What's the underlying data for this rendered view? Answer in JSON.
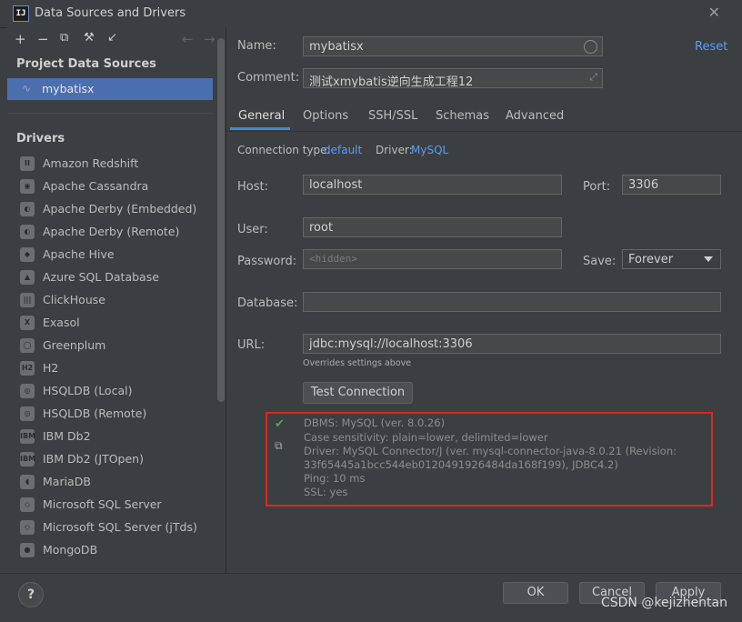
{
  "window": {
    "title": "Data Sources and Drivers",
    "app_icon": "IJ"
  },
  "left": {
    "toolbar": [
      "+",
      "−",
      "⧉",
      "🔧",
      "⇲",
      "←",
      "→"
    ],
    "project_section": "Project Data Sources",
    "selected_source": "mybatisx",
    "drivers_section": "Drivers",
    "drivers": [
      {
        "label": "Amazon Redshift",
        "icon": "II"
      },
      {
        "label": "Apache Cassandra",
        "icon": "◉"
      },
      {
        "label": "Apache Derby (Embedded)",
        "icon": "◐"
      },
      {
        "label": "Apache Derby (Remote)",
        "icon": "◐"
      },
      {
        "label": "Apache Hive",
        "icon": "◆"
      },
      {
        "label": "Azure SQL Database",
        "icon": "▲"
      },
      {
        "label": "ClickHouse",
        "icon": "|||"
      },
      {
        "label": "Exasol",
        "icon": "X"
      },
      {
        "label": "Greenplum",
        "icon": "◯"
      },
      {
        "label": "H2",
        "icon": "H2"
      },
      {
        "label": "HSQLDB (Local)",
        "icon": "◎"
      },
      {
        "label": "HSQLDB (Remote)",
        "icon": "◎"
      },
      {
        "label": "IBM Db2",
        "icon": "IBM"
      },
      {
        "label": "IBM Db2 (JTOpen)",
        "icon": "IBM"
      },
      {
        "label": "MariaDB",
        "icon": "◖"
      },
      {
        "label": "Microsoft SQL Server",
        "icon": "◇"
      },
      {
        "label": "Microsoft SQL Server (jTds)",
        "icon": "◇"
      },
      {
        "label": "MongoDB",
        "icon": "●"
      }
    ]
  },
  "form": {
    "name_label": "Name:",
    "name_value": "mybatisx",
    "reset_link": "Reset",
    "comment_label": "Comment:",
    "comment_value": "测试xmybatis逆向生成工程12",
    "tabs": [
      "General",
      "Options",
      "SSH/SSL",
      "Schemas",
      "Advanced"
    ],
    "active_tab": "General",
    "conn_type_label": "Connection type:",
    "conn_type_value": "default",
    "driver_label": "Driver:",
    "driver_value": "MySQL",
    "host_label": "Host:",
    "host_value": "localhost",
    "port_label": "Port:",
    "port_value": "3306",
    "user_label": "User:",
    "user_value": "root",
    "password_label": "Password:",
    "password_placeholder": "<hidden>",
    "save_label": "Save:",
    "save_value": "Forever",
    "database_label": "Database:",
    "database_value": "",
    "url_label": "URL:",
    "url_value": "jdbc:mysql://localhost:3306",
    "url_hint": "Overrides settings above",
    "test_button": "Test Connection"
  },
  "result": {
    "lines": [
      "DBMS: MySQL (ver. 8.0.26)",
      "Case sensitivity: plain=lower, delimited=lower",
      "Driver: MySQL Connector/J (ver. mysql-connector-java-8.0.21 (Revision:",
      "33f65445a1bcc544eb0120491926484da168f199), JDBC4.2)",
      "Ping: 10 ms",
      "SSL: yes"
    ],
    "highlight_color": "#e0261e"
  },
  "footer": {
    "ok": "OK",
    "cancel": "Cancel",
    "apply": "Apply",
    "help": "?",
    "watermark": "CSDN @kejizhentan"
  }
}
